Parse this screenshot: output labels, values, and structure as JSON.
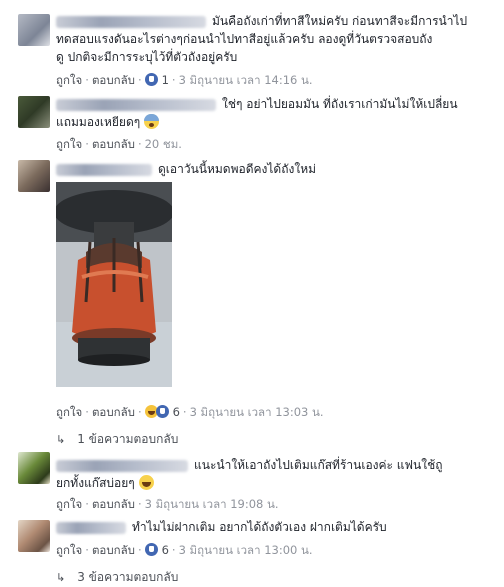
{
  "comments": [
    {
      "text_line1": "มันคือถังเก่าที่ทาสีใหม่ครับ ก่อนทาสีจะมีการนำไป",
      "text_line2": "ทดสอบแรงดันอะไรต่างๆก่อนนำไปทาสีอยู่แล้วครับ ลองดูที่วันตรวจสอบถัง",
      "text_line3": "ดู ปกติจะมีการระบุไว้ที่ตัวถังอยู่ครับ",
      "like_label": "ถูกใจ",
      "reply_label": "ตอบกลับ",
      "reaction_count": "1",
      "time": "3 มิถุนายน เวลา 14:16 น."
    },
    {
      "text_line1": "ใช่ๆ อย่าไปยอมมัน ที่ถังเราเก่ามันไม่ให้เปลี่ยน",
      "text_line2": "แถมมองเหยียดๆ",
      "like_label": "ถูกใจ",
      "reply_label": "ตอบกลับ",
      "time": "20 ชม."
    },
    {
      "text_line1": "ดูเอาวันนี้หมดพอดีคงได้ถังใหม่",
      "like_label": "ถูกใจ",
      "reply_label": "ตอบกลับ",
      "reaction_count": "6",
      "time": "3 มิถุนายน เวลา 13:03 น.",
      "replies_text": "1 ข้อความตอบกลับ"
    },
    {
      "text_line1": "แนะนำให้เอาถังไปเติมแก๊สที่ร้านเองค่ะ แฟนใช้ถู",
      "text_line2": "ยกทั้งแก๊สบ่อยๆ",
      "like_label": "ถูกใจ",
      "reply_label": "ตอบกลับ",
      "time": "3 มิถุนายน เวลา 19:08 น."
    },
    {
      "text_line1": "ทำไมไม่ฝากเติม อยากได้ถังตัวเอง ฝากเติมได้ครับ",
      "like_label": "ถูกใจ",
      "reply_label": "ตอบกลับ",
      "reaction_count": "6",
      "time": "3 มิถุนายน เวลา 13:00 น.",
      "replies_text": "3 ข้อความตอบกลับ"
    }
  ],
  "icons": {
    "like": "like-icon",
    "haha": "haha-icon",
    "fear": "fearful-emoji-icon",
    "laugh": "laughing-emoji-icon",
    "reply_arrow": "reply-arrow-icon"
  },
  "colors": {
    "link": "#4b4f56",
    "meta": "#90949c",
    "like_blue": "#4267b2"
  }
}
